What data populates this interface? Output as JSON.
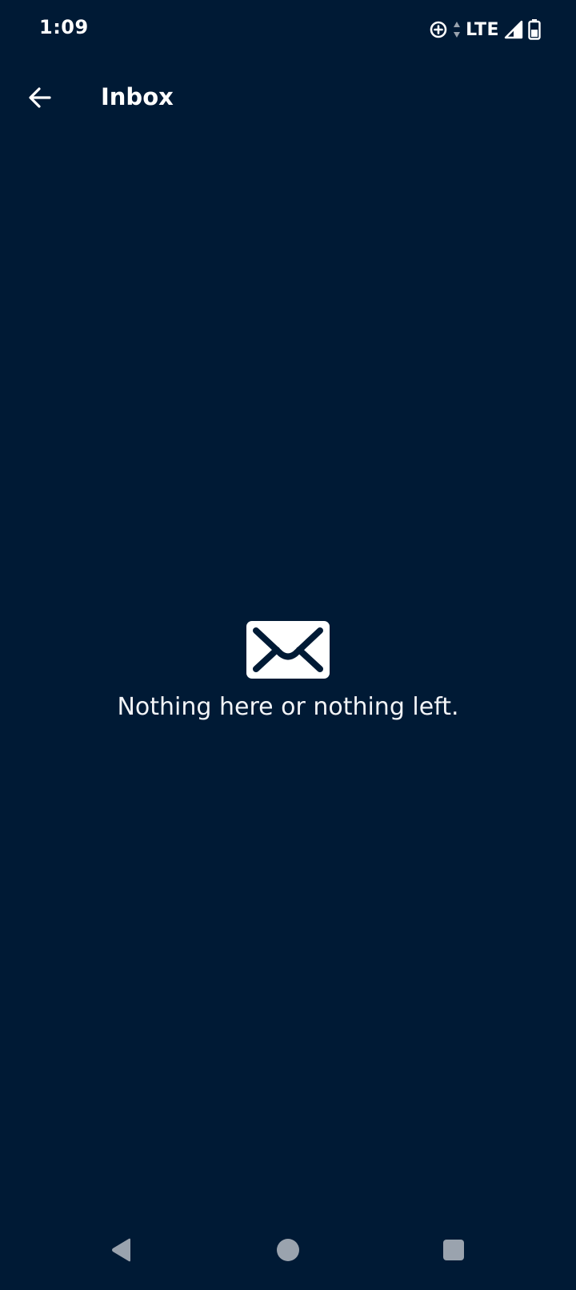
{
  "status_bar": {
    "time": "1:09",
    "network": "LTE",
    "icons": [
      "data-saver-icon",
      "data-arrows-icon",
      "signal-icon",
      "battery-icon"
    ]
  },
  "app_bar": {
    "title": "Inbox",
    "back_icon": "arrow-left-icon"
  },
  "empty_state": {
    "icon": "envelope-icon",
    "message": "Nothing here or nothing left."
  },
  "nav_bar": {
    "icons": [
      "nav-back-icon",
      "nav-home-icon",
      "nav-recents-icon"
    ]
  },
  "colors": {
    "background": "#001a35",
    "foreground": "#ffffff",
    "nav_icon": "#9aa3ae"
  }
}
